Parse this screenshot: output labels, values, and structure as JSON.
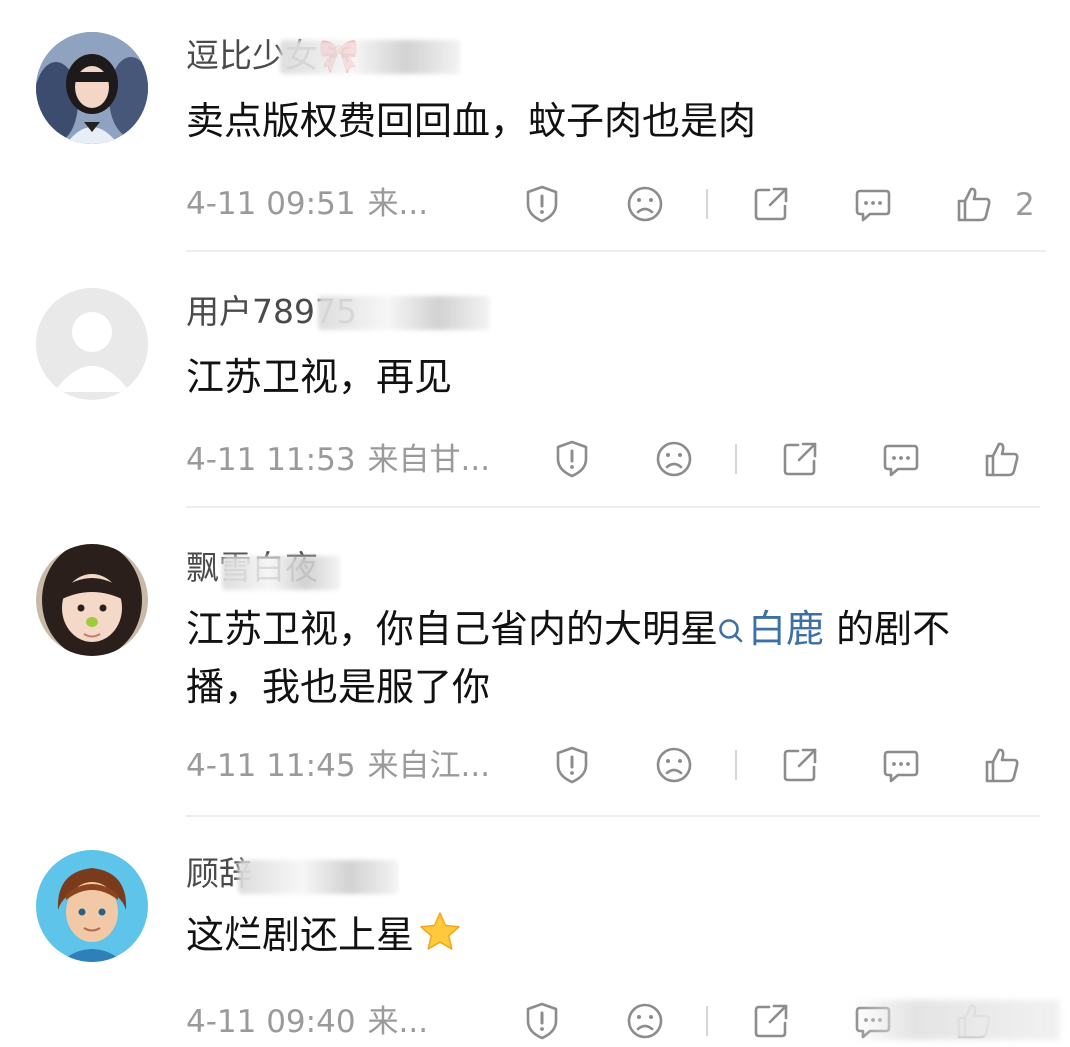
{
  "comments": [
    {
      "username": "逗比少女🎀",
      "text": "卖点版权费回回血，蚊子肉也是肉",
      "time": "4-11 09:51",
      "source": "来...",
      "likes": "2"
    },
    {
      "username": "用户78975",
      "text": "江苏卫视，再见",
      "time": "4-11 11:53",
      "source": "来自甘...",
      "likes": ""
    },
    {
      "username": "飘雪白夜",
      "text_part1": "江苏卫视，你自己省内的大明星",
      "topic": "白鹿",
      "text_part2": " 的剧不播，我也是服了你",
      "time": "4-11 11:45",
      "source": "来自江...",
      "likes": ""
    },
    {
      "username": "顾辞",
      "text": "这烂剧还上星",
      "time": "4-11 09:40",
      "source": "来...",
      "likes": ""
    }
  ],
  "icons": {
    "report": "report-icon",
    "dislike": "dislike-face-icon",
    "share": "share-icon",
    "reply": "reply-icon",
    "like": "thumbs-up-icon",
    "topic": "search-icon",
    "emoji": "star-emoji-icon"
  },
  "colors": {
    "topic_link": "#3d6fa8",
    "meta_text": "#9a9a9a",
    "icon_stroke": "#8c8c8c"
  }
}
